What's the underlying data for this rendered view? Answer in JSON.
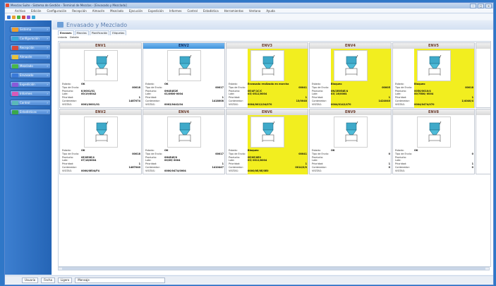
{
  "window": {
    "title": "Mesclas Suite - Sistema de Gestión - Terminal de Mezclas - [Envasado y Mezclado]"
  },
  "menu": [
    "Archivo",
    "Edición",
    "Configuración",
    "Recepción",
    "Almacén",
    "Mezclado",
    "Ejecución",
    "Expedición",
    "Informes",
    "Control",
    "Estadística",
    "Herramientas",
    "Ventana",
    "Ayuda"
  ],
  "toolbar_icons": [
    "new-icon",
    "open-icon",
    "save-icon",
    "refresh-icon",
    "print-icon",
    "help-icon"
  ],
  "sidebar": {
    "items": [
      {
        "label": "Sistema",
        "icon": "system-icon",
        "color": "#f0a030"
      },
      {
        "label": "Configuración",
        "icon": "config-icon",
        "color": "#3aa9d8"
      },
      {
        "label": "Recepción",
        "icon": "reception-icon",
        "color": "#d84a3a"
      },
      {
        "label": "Almacén",
        "icon": "warehouse-icon",
        "color": "#e8c23a"
      },
      {
        "label": "Mezclado",
        "icon": "mixing-icon",
        "color": "#4ab84a"
      },
      {
        "label": "Envasado",
        "icon": "packaging-icon",
        "color": "#3a7ad8"
      },
      {
        "label": "Expedición",
        "icon": "shipping-icon",
        "color": "#8a5ad8"
      },
      {
        "label": "Informes",
        "icon": "reports-icon",
        "color": "#d85ab8"
      },
      {
        "label": "Control",
        "icon": "control-icon",
        "color": "#5ab8b8"
      },
      {
        "label": "Estadísticas",
        "icon": "stats-icon",
        "color": "#3aa84a"
      }
    ]
  },
  "content": {
    "title": "Envasado y Mezclado",
    "tabs": [
      "Envases",
      "Mezclas",
      "Planificación",
      "Etiquetas"
    ],
    "subtabs": [
      "Listado",
      "Detalle"
    ]
  },
  "field_labels": [
    "Estado:",
    "Tipo de Envío:",
    "Producto:",
    "Lote:",
    "Prioridad:",
    "Contenedor:",
    "VISITAS:"
  ],
  "cards": [
    {
      "name": "ENV1",
      "highlight": false,
      "yellow": false,
      "values": [
        "OK",
        "",
        "K/0001/01",
        "00/19/0042",
        "",
        "",
        "0001/0001/01"
      ],
      "nums": [
        "",
        "00018",
        "",
        "",
        "1",
        "1487074",
        ""
      ]
    },
    {
      "name": "ENV2",
      "highlight": true,
      "yellow": false,
      "values": [
        "OK",
        "",
        "0H4E4E2E",
        "01/0600-0004",
        "",
        "",
        "0002/0442/04"
      ],
      "nums": [
        "",
        "00017",
        "",
        "",
        "1",
        "1418008",
        ""
      ]
    },
    {
      "name": "ENV3",
      "highlight": false,
      "yellow": true,
      "values": [
        "Envasado realizado en marcha",
        "",
        "0E/4F/1C/C",
        "03/ 0011/0004",
        "",
        "",
        "0004/0012/04/070"
      ],
      "nums": [
        "",
        "00041",
        "",
        "",
        "1",
        "13/0048",
        ""
      ]
    },
    {
      "name": "ENV4",
      "highlight": false,
      "yellow": true,
      "values": [
        "Bloqueo",
        "",
        "0N/2E0E4E/4",
        "03/ 16/0004",
        "",
        "",
        "0004/0142/470"
      ],
      "nums": [
        "",
        "00005",
        "",
        "",
        "1",
        "1424040",
        ""
      ]
    },
    {
      "name": "ENV5",
      "highlight": false,
      "yellow": true,
      "values": [
        "Bloqueo",
        "",
        "0050/0010/4",
        "00/7600/ 0004",
        "",
        "",
        "0004/0474/070"
      ],
      "nums": [
        "",
        "00018",
        "",
        "",
        "1",
        "1/4040/4",
        ""
      ]
    },
    {
      "name": "ENV2",
      "highlight": false,
      "yellow": false,
      "values": [
        "OK",
        "",
        "0E/0E0E/4",
        "07/18/0004",
        "",
        "",
        "0000/0E04/F4"
      ],
      "nums": [
        "",
        "00018",
        "",
        "",
        "1",
        "1487040",
        ""
      ]
    },
    {
      "name": "ENV4",
      "highlight": false,
      "yellow": false,
      "values": [
        "OK",
        "",
        "0H4E4E/0",
        "00/0E/ 0004",
        "",
        "",
        "0000/0474/0004"
      ],
      "nums": [
        "",
        "00017",
        "",
        "",
        "1",
        "1410447",
        ""
      ]
    },
    {
      "name": "ENV6",
      "highlight": false,
      "yellow": true,
      "values": [
        "Bloqueo",
        "",
        "0E/0E/0E0",
        "03/ 0011/0004",
        "",
        "",
        "0000/0E/0E/0E0"
      ],
      "nums": [
        "",
        "00041",
        "",
        "",
        "1",
        "0014/0/0",
        ""
      ]
    },
    {
      "name": "ENV9",
      "highlight": false,
      "yellow": false,
      "values": [
        "OK",
        "",
        "",
        "",
        "",
        "",
        ""
      ],
      "nums": [
        "",
        "0",
        "",
        "",
        "1",
        "0",
        ""
      ]
    },
    {
      "name": "ENV8",
      "highlight": false,
      "yellow": false,
      "values": [
        "OK",
        "",
        "",
        "",
        "",
        "",
        ""
      ],
      "nums": [
        "",
        "0",
        "",
        "",
        "1",
        "0",
        ""
      ]
    }
  ],
  "statusbar": [
    "Usuario",
    "Fecha",
    "Ligero",
    "Mensaje"
  ],
  "colors": {
    "accent": "#3f93db",
    "yellow": "#f2ee1f",
    "sidebar": "#2f6fc4"
  }
}
